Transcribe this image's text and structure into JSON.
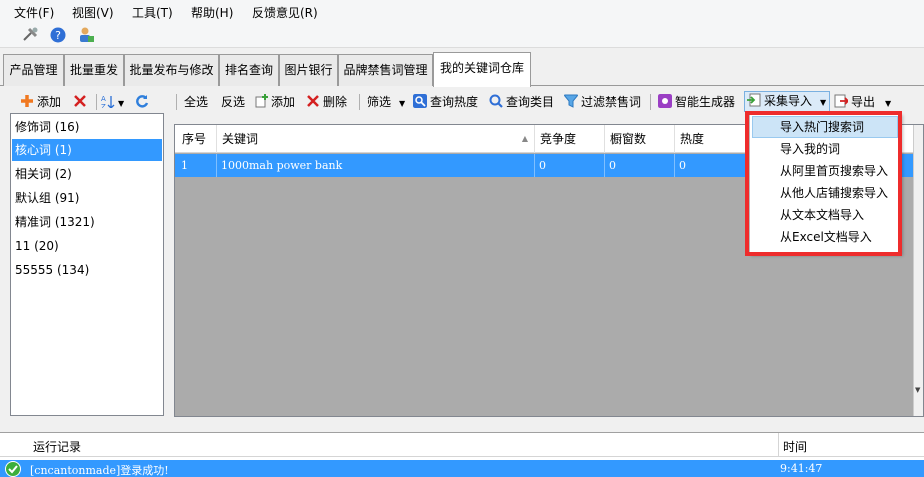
{
  "menu": [
    "文件(F)",
    "视图(V)",
    "工具(T)",
    "帮助(H)",
    "反馈意见(R)"
  ],
  "tabs": [
    "产品管理",
    "批量重发",
    "批量发布与修改",
    "排名查询",
    "图片银行",
    "品牌禁售词管理",
    "我的关键词仓库"
  ],
  "left_toolbar": {
    "add": "添加"
  },
  "groups": [
    {
      "label": "修饰词  (16)"
    },
    {
      "label": "核心词  (1)"
    },
    {
      "label": "相关词  (2)"
    },
    {
      "label": "默认组  (91)"
    },
    {
      "label": "精准词  (1321)"
    },
    {
      "label": "11  (20)"
    },
    {
      "label": "55555  (134)"
    }
  ],
  "toolbar": {
    "select_all": "全选",
    "invert": "反选",
    "add": "添加",
    "delete": "删除",
    "filter": "筛选",
    "query_heat": "查询热度",
    "query_category": "查询类目",
    "filter_banned": "过滤禁售词",
    "smart_gen": "智能生成器",
    "collect_import": "采集导入",
    "export": "导出"
  },
  "grid": {
    "columns": [
      "序号",
      "关键词",
      "竞争度",
      "橱窗数",
      "热度"
    ],
    "rows": [
      [
        "1",
        "1000mah power bank",
        "0",
        "0",
        "0"
      ]
    ]
  },
  "import_menu": [
    "导入热门搜索词",
    "导入我的词",
    "从阿里首页搜索导入",
    "从他人店铺搜索导入",
    "从文本文档导入",
    "从Excel文档导入"
  ],
  "log": {
    "col_record": "运行记录",
    "col_time": "时间",
    "message": "[cncantonmade]登录成功!",
    "time": "9:41:47"
  },
  "colors": {
    "selection": "#3399ff",
    "highlight_border": "#ee2c2c",
    "grid_bg": "#ababab"
  }
}
